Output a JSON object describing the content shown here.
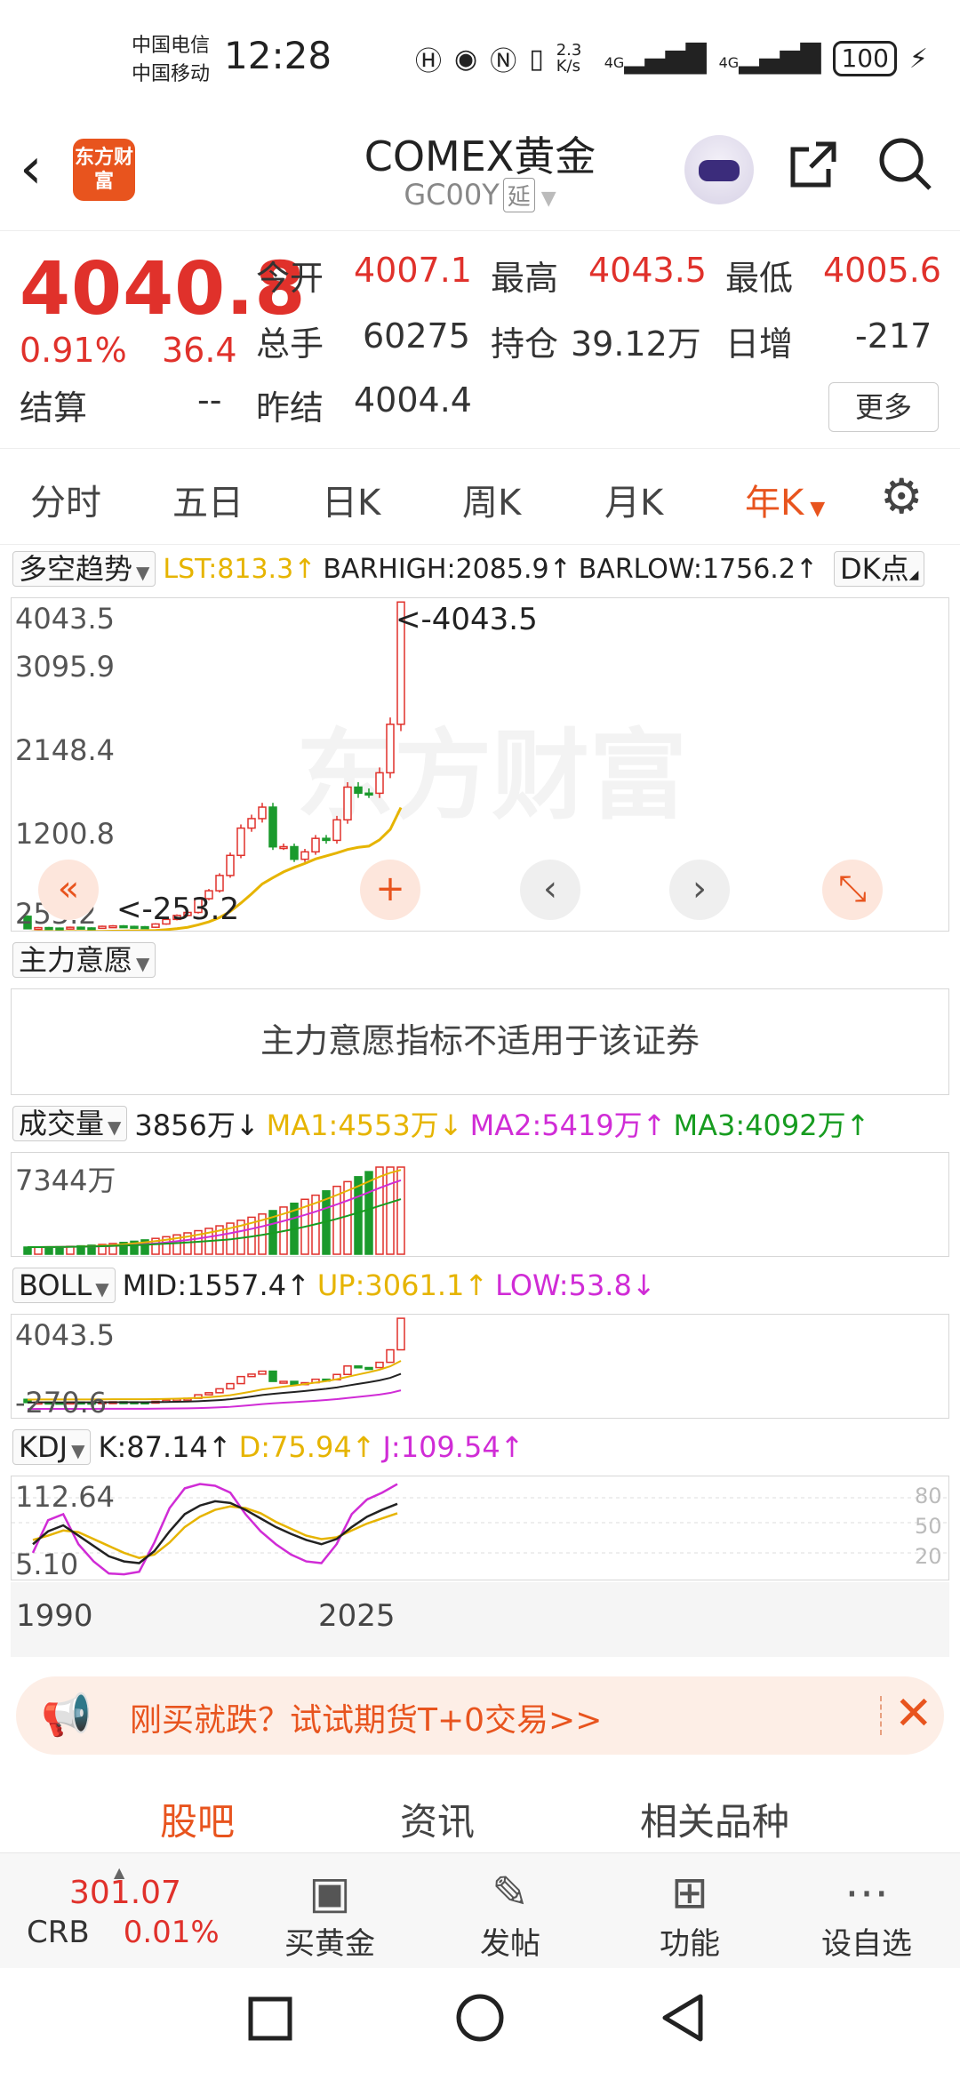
{
  "status_bar": {
    "carrier1": "中国电信",
    "carrier2": "中国移动",
    "time": "12:28",
    "speed": "2.3 K/s",
    "net1": "4G",
    "net2": "4G",
    "battery": "100"
  },
  "header": {
    "logo": "东方财富",
    "title": "COMEX黄金",
    "code": "GC00Y",
    "delay_tag": "延"
  },
  "quote": {
    "price": "4040.8",
    "change_pct": "0.91%",
    "change": "36.4",
    "open_label": "今开",
    "open": "4007.1",
    "high_label": "最高",
    "high": "4043.5",
    "low_label": "最低",
    "low": "4005.6",
    "volume_label": "总手",
    "volume": "60275",
    "oi_label": "持仓",
    "oi": "39.12万",
    "daily_inc_label": "日增",
    "daily_inc": "-217",
    "settle_label": "结算",
    "settle": "--",
    "prev_settle_label": "昨结",
    "prev_settle": "4004.4",
    "more": "更多"
  },
  "tabs": [
    "分时",
    "五日",
    "日K",
    "周K",
    "月K",
    "年K"
  ],
  "active_tab": "年K",
  "main_indicator": {
    "name": "多空趋势",
    "lst": "LST:813.3",
    "barhigh": "BARHIGH:2085.9",
    "barlow": "BARLOW:1756.2",
    "dk_button": "DK点",
    "y_labels": [
      "4043.5",
      "3095.9",
      "2148.4",
      "1200.8",
      "253.2"
    ],
    "high_marker": "<-4043.5",
    "low_marker": "<-253.2",
    "watermark": "东方财富"
  },
  "willingness": {
    "name": "主力意愿",
    "message": "主力意愿指标不适用于该证券"
  },
  "volume": {
    "name": "成交量",
    "value": "3856万",
    "ma1": "MA1:4553万",
    "ma2": "MA2:5419万",
    "ma3": "MA3:4092万",
    "y_label": "7344万"
  },
  "boll": {
    "name": "BOLL",
    "mid": "MID:1557.4",
    "up": "UP:3061.1",
    "low": "LOW:53.8",
    "y_top": "4043.5",
    "y_bottom": "-270.6"
  },
  "kdj": {
    "name": "KDJ",
    "k": "K:87.14",
    "d": "D:75.94",
    "j": "J:109.54",
    "y_top": "112.64",
    "y_bottom": "5.10",
    "levels": [
      "80",
      "50",
      "20"
    ],
    "x_start": "1990",
    "x_end": "2025"
  },
  "colors": {
    "up": "#e0312b",
    "down": "#1a9a2c",
    "accent": "#e8541e",
    "ma1": "#e6b400",
    "ma2": "#d02cd6",
    "ma3": "#179c20"
  },
  "banner": {
    "text": "刚买就跌？试试期货T+0交易>>"
  },
  "bottom_tabs": [
    "股吧",
    "资讯",
    "相关品种"
  ],
  "bottom_nav": {
    "crb_value": "301.07",
    "crb_label": "CRB",
    "crb_change": "0.01%",
    "items": [
      "买黄金",
      "发帖",
      "功能",
      "设自选"
    ]
  },
  "chart_data": {
    "type": "candlestick",
    "x_start_label": "1990",
    "x_end_label": "2025",
    "closes": [
      255,
      268,
      262,
      258,
      272,
      264,
      260,
      283,
      288,
      282,
      278,
      272,
      310,
      363,
      409,
      444,
      603,
      695,
      872,
      1105,
      1421,
      1531,
      1664,
      1204,
      1206,
      1060,
      1146,
      1302,
      1279,
      1517,
      1896,
      1826,
      1825,
      2062,
      2624,
      4040.8
    ],
    "opens": [
      399,
      255,
      268,
      262,
      258,
      272,
      264,
      260,
      283,
      288,
      282,
      278,
      272,
      310,
      363,
      409,
      444,
      603,
      695,
      872,
      1105,
      1421,
      1531,
      1664,
      1204,
      1206,
      1060,
      1146,
      1302,
      1279,
      1517,
      1896,
      1826,
      1825,
      2062,
      2624
    ],
    "high_label_value": 4043.5,
    "low_label_value": 253.2
  }
}
